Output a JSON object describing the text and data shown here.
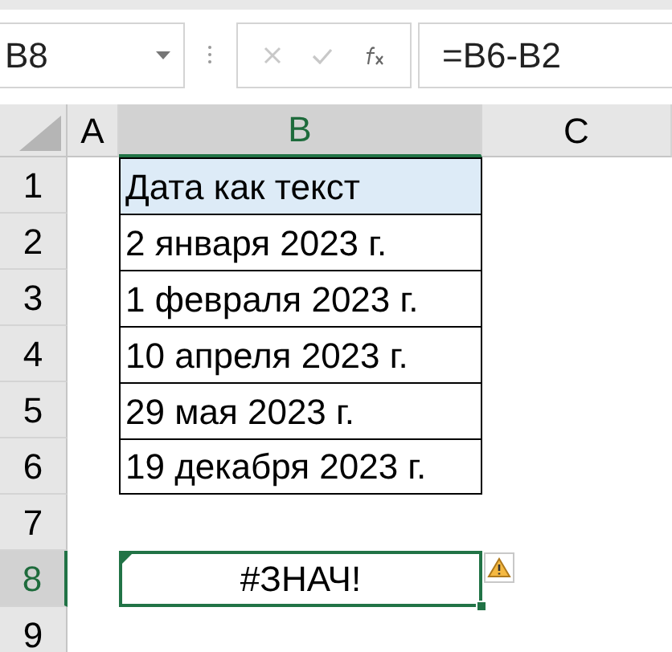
{
  "name_box": {
    "value": "B8"
  },
  "formula_bar": {
    "value": "=B6-B2"
  },
  "columns": [
    {
      "label": "A",
      "selected": false
    },
    {
      "label": "B",
      "selected": true
    },
    {
      "label": "C",
      "selected": false
    }
  ],
  "rows": [
    {
      "label": "1",
      "selected": false,
      "b": "Дата как текст",
      "kind": "header"
    },
    {
      "label": "2",
      "selected": false,
      "b": "2 января 2023 г.",
      "kind": "date"
    },
    {
      "label": "3",
      "selected": false,
      "b": "1 февраля 2023 г.",
      "kind": "date"
    },
    {
      "label": "4",
      "selected": false,
      "b": "10 апреля 2023 г.",
      "kind": "date"
    },
    {
      "label": "5",
      "selected": false,
      "b": "29 мая 2023 г.",
      "kind": "date"
    },
    {
      "label": "6",
      "selected": false,
      "b": "19 декабря 2023 г.",
      "kind": "date"
    },
    {
      "label": "7",
      "selected": false,
      "kind": "empty"
    },
    {
      "label": "8",
      "selected": true,
      "b": "#ЗНАЧ!",
      "kind": "error"
    },
    {
      "label": "9",
      "selected": false,
      "kind": "empty"
    }
  ]
}
